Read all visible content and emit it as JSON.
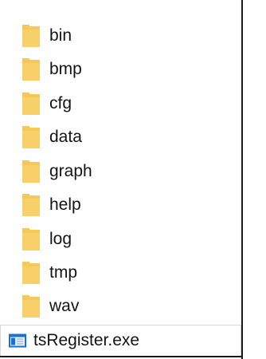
{
  "folders": [
    {
      "name": "bin"
    },
    {
      "name": "bmp"
    },
    {
      "name": "cfg"
    },
    {
      "name": "data"
    },
    {
      "name": "graph"
    },
    {
      "name": "help"
    },
    {
      "name": "log"
    },
    {
      "name": "tmp"
    },
    {
      "name": "wav"
    }
  ],
  "files": [
    {
      "name": "tsRegister.exe",
      "icon": "exe-window-icon"
    }
  ],
  "colors": {
    "folder_yellow": "#f4c95a",
    "folder_light": "#fbe39b",
    "exe_blue": "#1f6fc9",
    "text": "#141414"
  }
}
